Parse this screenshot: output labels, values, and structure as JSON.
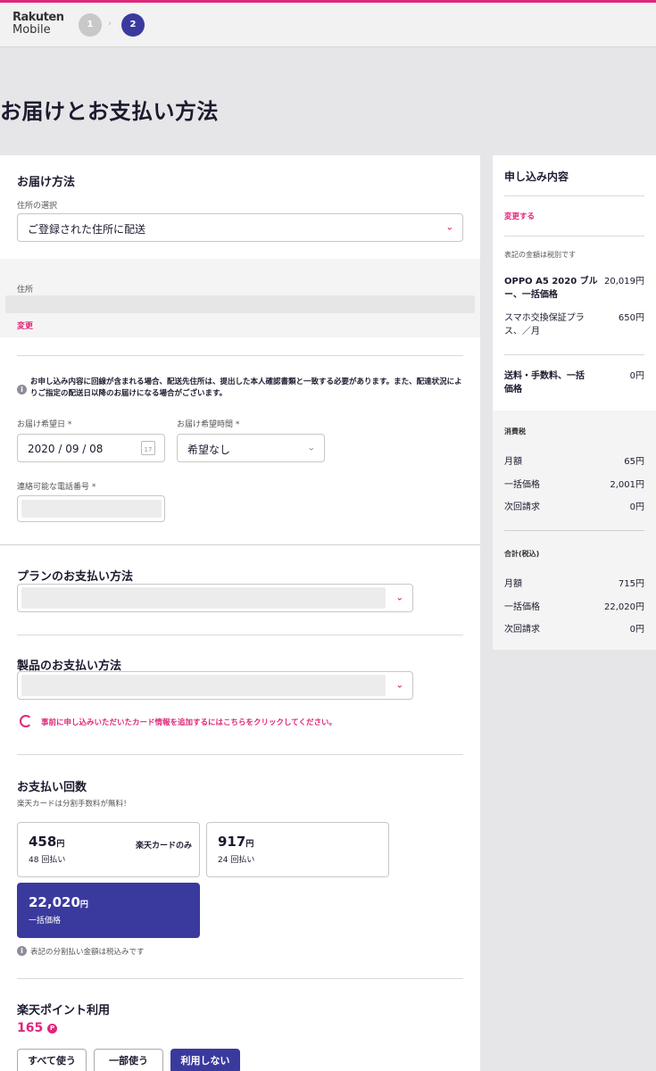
{
  "header": {
    "logo_line1": "Rakuten",
    "logo_line2": "Mobile",
    "steps": [
      "1",
      "2"
    ],
    "separator": "›"
  },
  "page_title": "お届けとお支払い方法",
  "delivery": {
    "title": "お届け方法",
    "address_select_label": "住所の選択",
    "address_select_value": "ご登録された住所に配送",
    "address_label": "住所",
    "change_link": "変更",
    "notice": "お申し込み内容に回線が含まれる場合、配送先住所は、提出した本人確認書類と一致する必要があります。また、配達状況によりご指定の配送日以降のお届けになる場合がございます。",
    "date_label": "お届け希望日 *",
    "date_value": "2020 / 09 / 08",
    "time_label": "お届け希望時間 *",
    "time_value": "希望なし",
    "phone_label": "連絡可能な電話番号 *"
  },
  "plan_payment": {
    "title": "プランのお支払い方法"
  },
  "product_payment": {
    "title": "製品のお支払い方法",
    "add_card_link": "事前に申し込みいただいたカード情報を追加するにはこちらをクリックしてください。"
  },
  "installments": {
    "title": "お支払い回数",
    "note": "楽天カードは分割手数料が無料！",
    "options": [
      {
        "amount": "458",
        "unit": "円",
        "sub": "48 回払い",
        "tag": "楽天カードのみ"
      },
      {
        "amount": "917",
        "unit": "円",
        "sub": "24 回払い"
      },
      {
        "amount": "22,020",
        "unit": "円",
        "sub": "一括価格"
      }
    ],
    "tax_note": "表記の分割払い金額は税込みです"
  },
  "points": {
    "title": "楽天ポイント利用",
    "value": "165",
    "buttons": [
      "すべて使う",
      "一部使う",
      "利用しない"
    ]
  },
  "summary": {
    "title": "申し込み内容",
    "change_link": "変更する",
    "tax_excluded_note": "表記の金額は税別です",
    "items": [
      {
        "name": "OPPO A5 2020 ブルー、一括価格",
        "price": "20,019円"
      },
      {
        "name": "スマホ交換保証プラス、／月",
        "price": "650円"
      }
    ],
    "shipping": {
      "name": "送料・手数料、一括価格",
      "price": "0円"
    },
    "tax": {
      "label": "消費税",
      "rows": [
        {
          "name": "月額",
          "price": "65円"
        },
        {
          "name": "一括価格",
          "price": "2,001円"
        },
        {
          "name": "次回請求",
          "price": "0円"
        }
      ]
    },
    "total": {
      "label": "合計(税込)",
      "rows": [
        {
          "name": "月額",
          "price": "715円"
        },
        {
          "name": "一括価格",
          "price": "22,020円"
        },
        {
          "name": "次回請求",
          "price": "0円"
        }
      ]
    }
  },
  "colors": {
    "accent": "#e0267a",
    "primary": "#3a3a9e"
  }
}
